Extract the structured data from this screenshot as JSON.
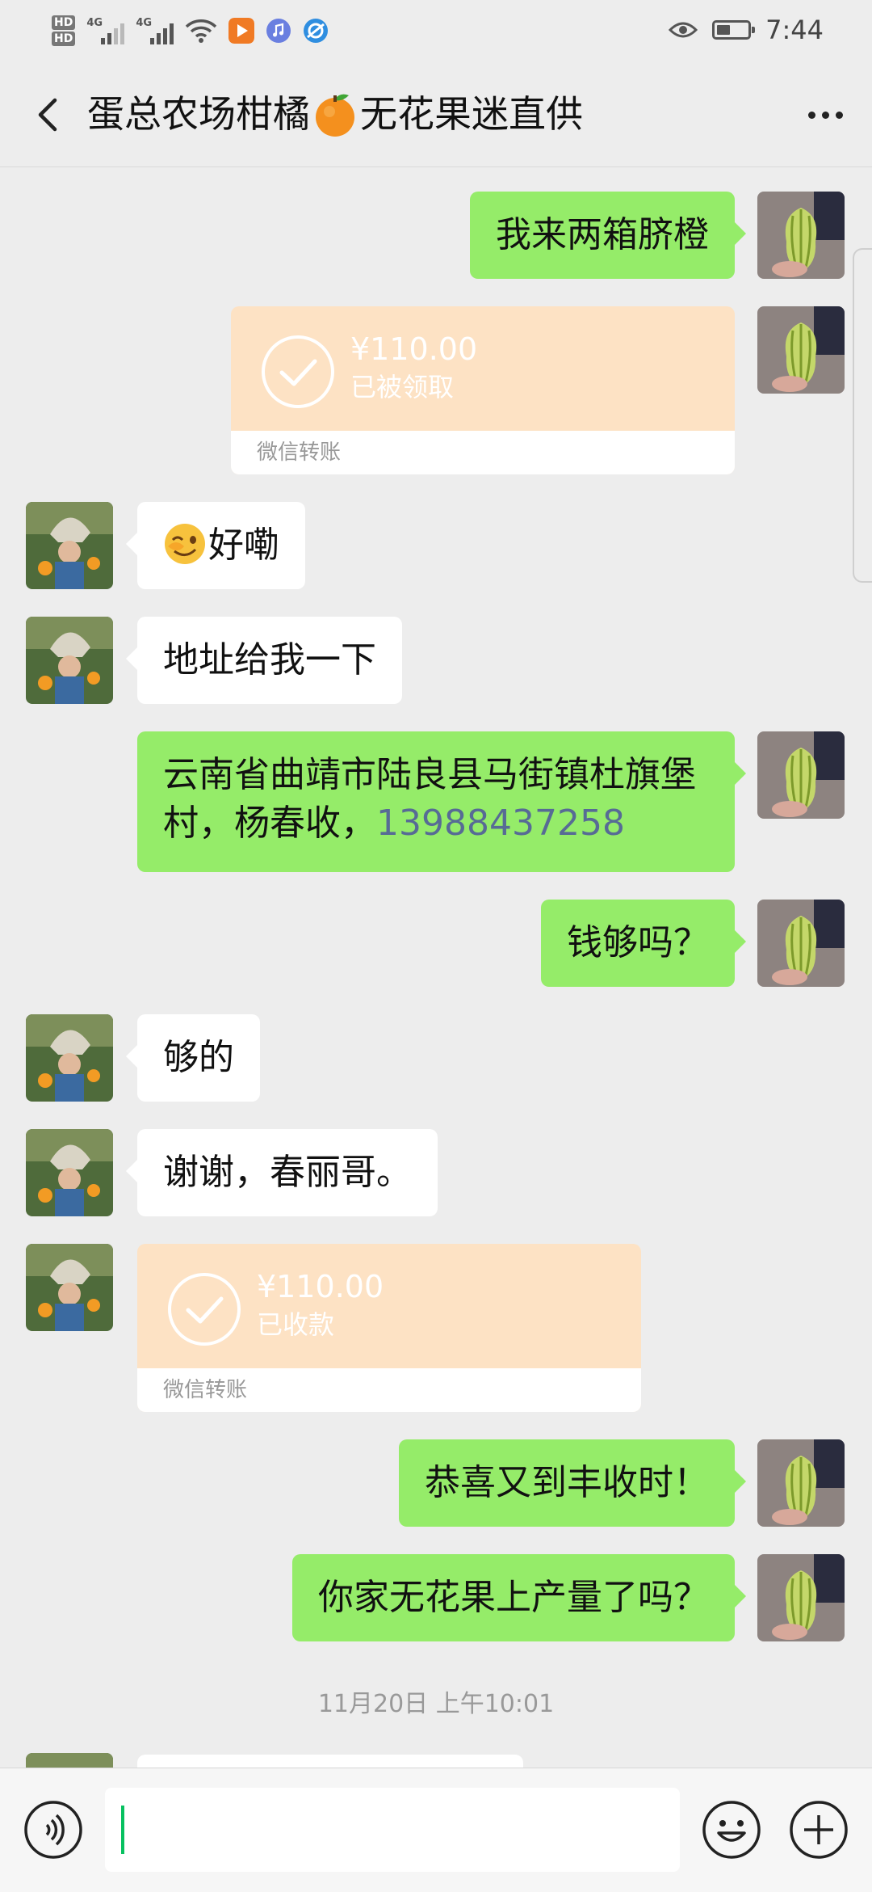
{
  "status_bar": {
    "hd1": "HD",
    "hd2": "HD",
    "net1": "4G",
    "net2": "4G",
    "time": "7:44"
  },
  "nav": {
    "title_part1": "蛋总农场柑橘",
    "title_part2": "无花果迷直供",
    "back_icon": "chevron-left-icon",
    "more_icon": "more-icon"
  },
  "messages": [
    {
      "side": "me",
      "type": "text",
      "text": "我来两箱脐橙"
    },
    {
      "side": "me",
      "type": "transfer",
      "amount": "¥110.00",
      "status": "已被领取",
      "label": "微信转账"
    },
    {
      "side": "them",
      "type": "text",
      "text": "好嘞",
      "emoji": "wink-emoji-icon"
    },
    {
      "side": "them",
      "type": "text",
      "text": "地址给我一下"
    },
    {
      "side": "me",
      "type": "text",
      "line1": "云南省曲靖市陆良县马街镇杜旗堡",
      "line2": "村，杨春收，",
      "phone": "13988437258"
    },
    {
      "side": "me",
      "type": "text",
      "text": "钱够吗？"
    },
    {
      "side": "them",
      "type": "text",
      "text": "够的"
    },
    {
      "side": "them",
      "type": "text",
      "text": "谢谢，春丽哥。"
    },
    {
      "side": "them",
      "type": "transfer",
      "amount": "¥110.00",
      "status": "已收款",
      "label": "微信转账"
    },
    {
      "side": "me",
      "type": "text",
      "text": "恭喜又到丰收时！"
    },
    {
      "side": "me",
      "type": "text",
      "text": "你家无花果上产量了吗？"
    }
  ],
  "timestamp": "11月20日 上午10:01",
  "input_bar": {
    "voice_icon": "voice-icon",
    "emoji_icon": "emoji-icon",
    "plus_icon": "plus-icon",
    "value": ""
  },
  "colors": {
    "my_bubble": "#95ec69",
    "their_bubble": "#ffffff",
    "transfer": "#fde2c4",
    "background": "#ededed",
    "phone_link": "#576b95"
  }
}
